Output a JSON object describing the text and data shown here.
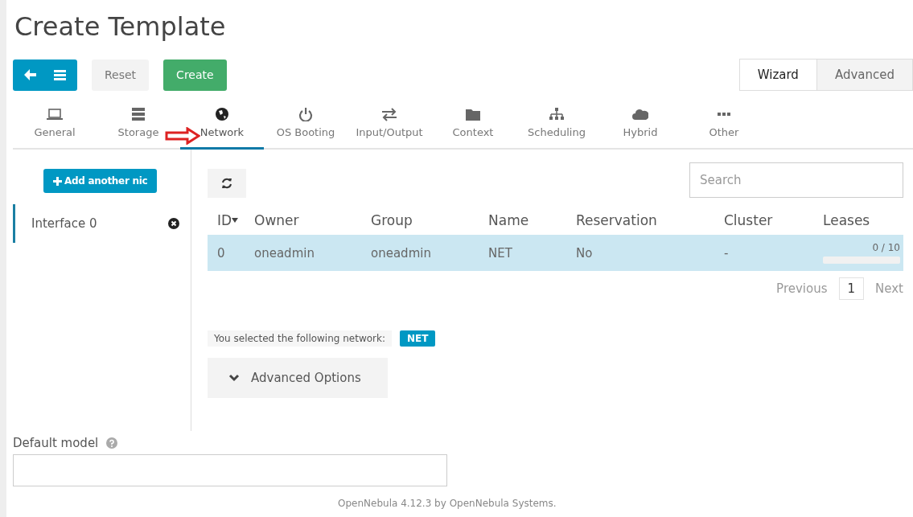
{
  "title": "Create Template",
  "toolbar": {
    "buttons": [
      {
        "label": "Reset",
        "kind": "reset"
      },
      {
        "label": "Create",
        "kind": "create"
      }
    ]
  },
  "mode_tabs": [
    {
      "label": "Wizard",
      "selected": true
    },
    {
      "label": "Advanced",
      "selected": false
    }
  ],
  "tabs": [
    {
      "label": "General",
      "selected": false
    },
    {
      "label": "Storage",
      "selected": false
    },
    {
      "label": "Network",
      "selected": true
    },
    {
      "label": "OS Booting",
      "selected": false
    },
    {
      "label": "Input/Output",
      "selected": false
    },
    {
      "label": "Context",
      "selected": false
    },
    {
      "label": "Scheduling",
      "selected": false
    },
    {
      "label": "Hybrid",
      "selected": false
    },
    {
      "label": "Other",
      "selected": false
    }
  ],
  "add_nic_button": "Add another nic",
  "interfaces": [
    {
      "label": "Interface 0",
      "selected": true
    }
  ],
  "search": {
    "placeholder": "Search"
  },
  "table": {
    "columns": [
      "ID",
      "Owner",
      "Group",
      "Name",
      "Reservation",
      "Cluster",
      "Leases"
    ],
    "rows": [
      {
        "cells": [
          "0",
          "oneadmin",
          "oneadmin",
          "NET",
          "No",
          "-"
        ],
        "leases": "0 / 10",
        "selected": true
      }
    ]
  },
  "pagination": {
    "previous": "Previous",
    "page": "1",
    "next": "Next"
  },
  "selection": {
    "text": "You selected the following network:",
    "badge": "NET"
  },
  "advanced_options": {
    "label": "Advanced Options",
    "expanded": false
  },
  "default_model": {
    "label": "Default model"
  },
  "footer": "OpenNebula 4.12.3 by OpenNebula Systems."
}
